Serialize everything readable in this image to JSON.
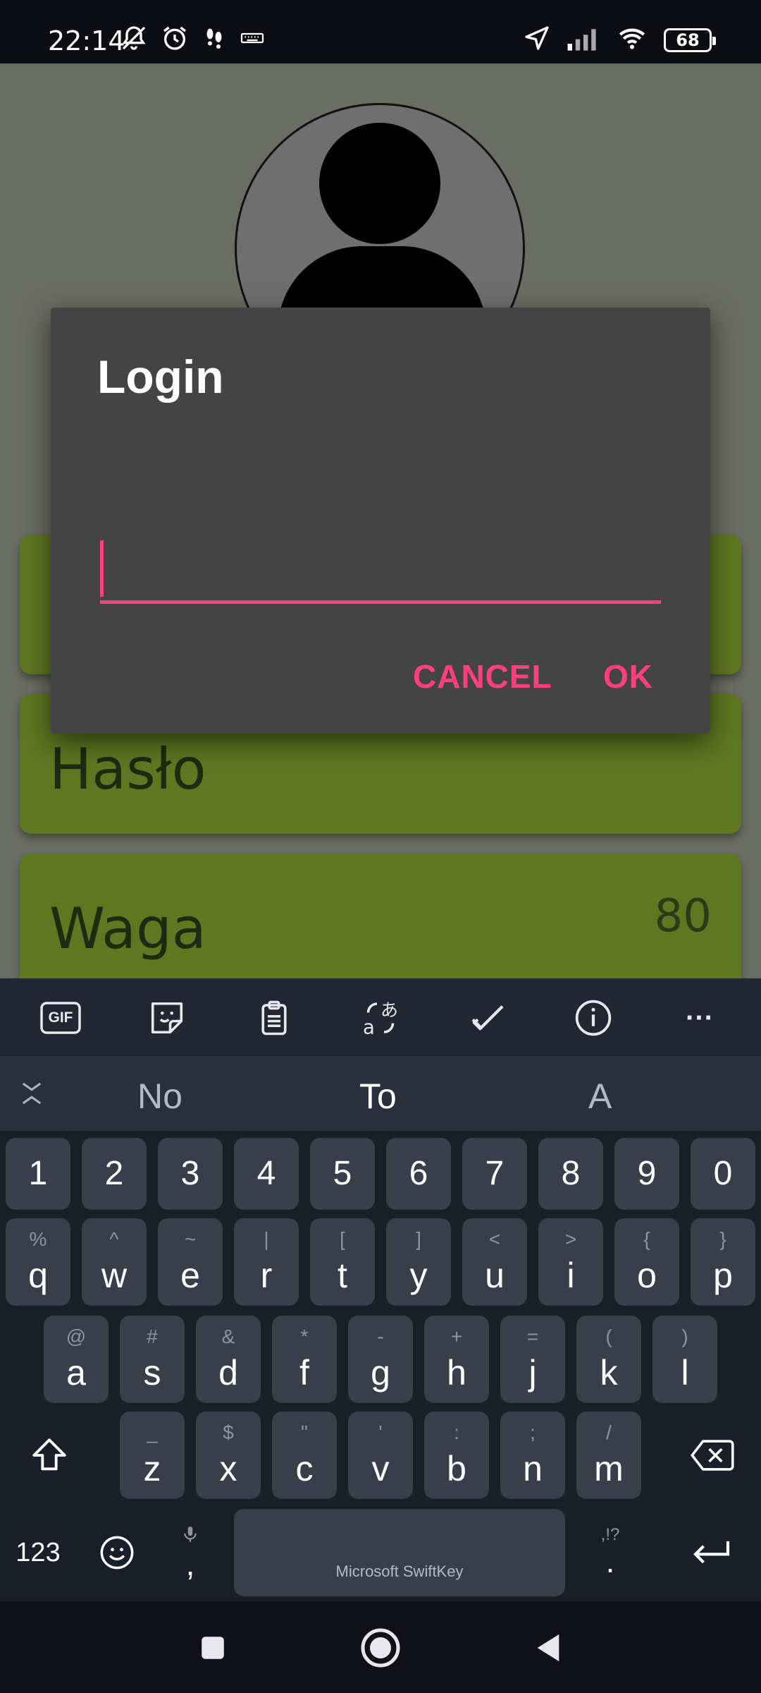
{
  "status_bar": {
    "time": "22:14",
    "battery": "68",
    "left_icons": [
      "bell-off-icon",
      "alarm-icon",
      "footsteps-icon",
      "keyboard-icon"
    ],
    "right_icons": [
      "location-icon",
      "signal-icon",
      "wifi-icon",
      "battery-icon"
    ]
  },
  "app": {
    "fields": [
      {
        "label": "Hasło",
        "value": ""
      },
      {
        "label": "Waga",
        "value": "80"
      }
    ],
    "accent_color": "#5f7721"
  },
  "dialog": {
    "title": "Login",
    "input_value": "",
    "cancel_label": "CANCEL",
    "ok_label": "OK",
    "accent_color": "#ff3f7f"
  },
  "keyboard": {
    "toolbar": [
      "gif-icon",
      "sticker-icon",
      "clipboard-icon",
      "translate-icon",
      "checkmark-icon",
      "info-icon",
      "more-icon"
    ],
    "gif_label": "GIF",
    "more_label": "···",
    "suggestions": [
      "No",
      "To",
      "A"
    ],
    "number_row": [
      "1",
      "2",
      "3",
      "4",
      "5",
      "6",
      "7",
      "8",
      "9",
      "0"
    ],
    "row1": {
      "keys": [
        "q",
        "w",
        "e",
        "r",
        "t",
        "y",
        "u",
        "i",
        "o",
        "p"
      ],
      "alts": [
        "%",
        "^",
        "~",
        "|",
        "[",
        "]",
        "<",
        ">",
        "{",
        "}"
      ]
    },
    "row2": {
      "keys": [
        "a",
        "s",
        "d",
        "f",
        "g",
        "h",
        "j",
        "k",
        "l"
      ],
      "alts": [
        "@",
        "#",
        "&",
        "*",
        "-",
        "+",
        "=",
        "(",
        ")"
      ]
    },
    "row3": {
      "keys": [
        "z",
        "x",
        "c",
        "v",
        "b",
        "n",
        "m"
      ],
      "alts": [
        "_",
        "$",
        "\"",
        "'",
        ":",
        ";",
        "/"
      ]
    },
    "numbers_label": "123",
    "comma_label": ",",
    "period_label": ".",
    "period_alt": ",!?",
    "space_label": "Microsoft SwiftKey"
  },
  "nav": {
    "icons": [
      "recents-icon",
      "home-icon",
      "back-icon"
    ]
  }
}
